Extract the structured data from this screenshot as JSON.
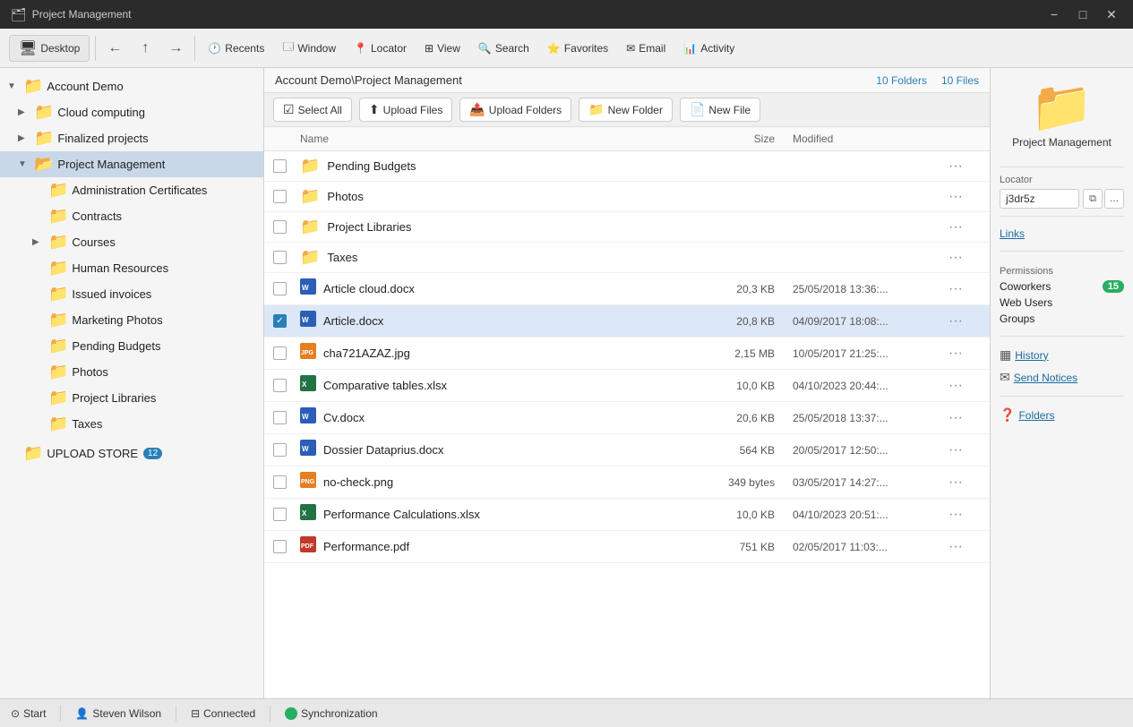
{
  "app": {
    "title": "Project Management",
    "titlebar_controls": [
      "minimize",
      "maximize",
      "close"
    ]
  },
  "toolbar": {
    "desktop_label": "Desktop",
    "recents_label": "Recents",
    "window_label": "Window",
    "locator_label": "Locator",
    "view_label": "View",
    "search_label": "Search",
    "favorites_label": "Favorites",
    "email_label": "Email",
    "activity_label": "Activity"
  },
  "sidebar": {
    "items": [
      {
        "id": "account-demo",
        "label": "Account Demo",
        "level": 0,
        "type": "root",
        "expanded": true
      },
      {
        "id": "cloud-computing",
        "label": "Cloud computing",
        "level": 1,
        "type": "folder",
        "expanded": false
      },
      {
        "id": "finalized-projects",
        "label": "Finalized projects",
        "level": 1,
        "type": "folder",
        "expanded": false
      },
      {
        "id": "project-management",
        "label": "Project Management",
        "level": 1,
        "type": "folder",
        "expanded": true,
        "active": true
      },
      {
        "id": "admin-certs",
        "label": "Administration Certificates",
        "level": 2,
        "type": "folder"
      },
      {
        "id": "contracts",
        "label": "Contracts",
        "level": 2,
        "type": "folder"
      },
      {
        "id": "courses",
        "label": "Courses",
        "level": 2,
        "type": "folder",
        "expanded": false
      },
      {
        "id": "human-resources",
        "label": "Human Resources",
        "level": 2,
        "type": "folder"
      },
      {
        "id": "issued-invoices",
        "label": "Issued invoices",
        "level": 2,
        "type": "folder"
      },
      {
        "id": "marketing-photos",
        "label": "Marketing Photos",
        "level": 2,
        "type": "folder"
      },
      {
        "id": "pending-budgets",
        "label": "Pending Budgets",
        "level": 2,
        "type": "folder"
      },
      {
        "id": "photos",
        "label": "Photos",
        "level": 2,
        "type": "folder"
      },
      {
        "id": "project-libraries",
        "label": "Project Libraries",
        "level": 2,
        "type": "folder"
      },
      {
        "id": "taxes",
        "label": "Taxes",
        "level": 2,
        "type": "folder"
      },
      {
        "id": "upload-store",
        "label": "UPLOAD STORE",
        "level": 0,
        "type": "folder",
        "badge": "12"
      }
    ]
  },
  "content": {
    "breadcrumb": "Account Demo\\Project Management",
    "folders_count": "10 Folders",
    "files_count": "10 Files",
    "toolbar": {
      "select_all": "Select All",
      "upload_files": "Upload Files",
      "upload_folders": "Upload Folders",
      "new_folder": "New Folder",
      "new_file": "New File"
    },
    "columns": {
      "name": "Name",
      "size": "Size",
      "modified": "Modified"
    },
    "items": [
      {
        "id": "pending-budgets-f",
        "name": "Pending Budgets",
        "type": "folder",
        "size": "",
        "modified": "",
        "selected": false
      },
      {
        "id": "photos-f",
        "name": "Photos",
        "type": "folder",
        "size": "",
        "modified": "",
        "selected": false
      },
      {
        "id": "project-libraries-f",
        "name": "Project Libraries",
        "type": "folder",
        "size": "",
        "modified": "",
        "selected": false
      },
      {
        "id": "taxes-f",
        "name": "Taxes",
        "type": "folder",
        "size": "",
        "modified": "",
        "selected": false
      },
      {
        "id": "article-cloud",
        "name": "Article cloud.docx",
        "type": "docx",
        "size": "20,3 KB",
        "modified": "25/05/2018 13:36:...",
        "selected": false
      },
      {
        "id": "article",
        "name": "Article.docx",
        "type": "docx",
        "size": "20,8 KB",
        "modified": "04/09/2017 18:08:...",
        "selected": true
      },
      {
        "id": "cha721",
        "name": "cha721AZAZ.jpg",
        "type": "jpg",
        "size": "2,15 MB",
        "modified": "10/05/2017 21:25:...",
        "selected": false
      },
      {
        "id": "comparative-tables",
        "name": "Comparative tables.xlsx",
        "type": "xlsx",
        "size": "10,0 KB",
        "modified": "04/10/2023 20:44:...",
        "selected": false
      },
      {
        "id": "cv",
        "name": "Cv.docx",
        "type": "docx",
        "size": "20,6 KB",
        "modified": "25/05/2018 13:37:...",
        "selected": false
      },
      {
        "id": "dossier",
        "name": "Dossier Dataprius.docx",
        "type": "docx",
        "size": "564 KB",
        "modified": "20/05/2017 12:50:...",
        "selected": false
      },
      {
        "id": "no-check",
        "name": "no-check.png",
        "type": "png",
        "size": "349 bytes",
        "modified": "03/05/2017 14:27:...",
        "selected": false
      },
      {
        "id": "perf-calc",
        "name": "Performance Calculations.xlsx",
        "type": "xlsx",
        "size": "10,0 KB",
        "modified": "04/10/2023 20:51:...",
        "selected": false
      },
      {
        "id": "performance-pdf",
        "name": "Performance.pdf",
        "type": "pdf",
        "size": "751 KB",
        "modified": "02/05/2017 11:03:...",
        "selected": false
      }
    ]
  },
  "right_panel": {
    "folder_name": "Project Management",
    "locator_label": "Locator",
    "locator_value": "j3dr5z",
    "links_label": "Links",
    "permissions_label": "Permissions",
    "permissions": [
      {
        "name": "Coworkers",
        "badge": "15"
      },
      {
        "name": "Web Users",
        "badge": null
      },
      {
        "name": "Groups",
        "badge": null
      }
    ],
    "history_label": "History",
    "send_notices_label": "Send Notices",
    "folders_help_label": "Folders"
  },
  "statusbar": {
    "start_label": "Start",
    "user_label": "Steven Wilson",
    "connected_label": "Connected",
    "sync_label": "Synchronization"
  }
}
